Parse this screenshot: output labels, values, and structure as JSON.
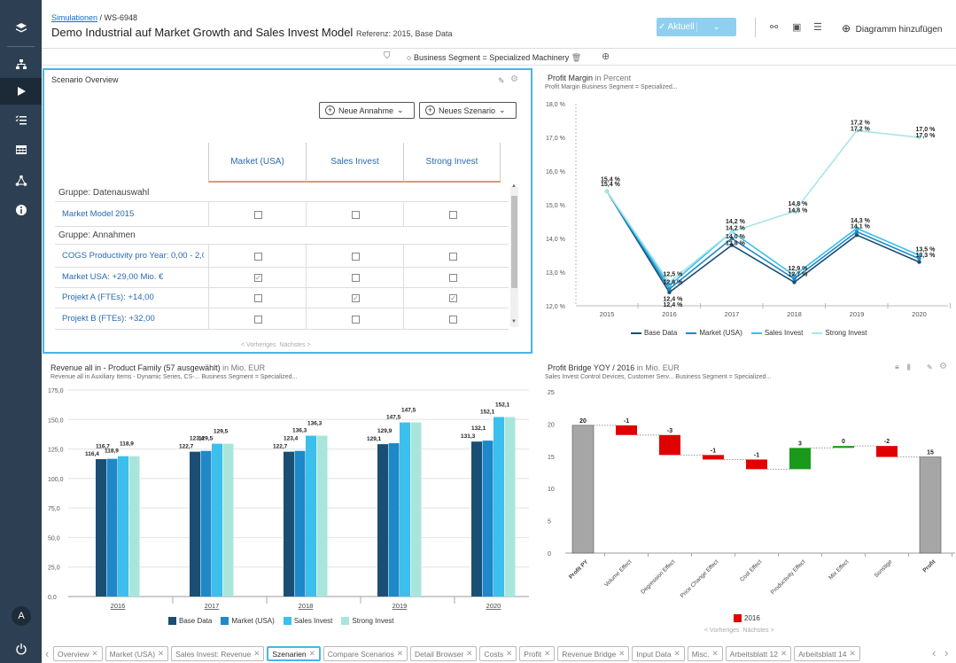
{
  "header": {
    "breadcrumb_link": "Simulationen",
    "breadcrumb_sep": " / ",
    "breadcrumb_id": "WS-6948",
    "title": "Demo Industrial auf Market Growth and Sales Invest Model",
    "reference": "Referenz: 2015, Base Data",
    "aktuell_label": "Aktuell",
    "add_diagram_label": "Diagramm hinzufügen"
  },
  "filter": {
    "label": "Business Segment = Specialized Machinery"
  },
  "scenario": {
    "title": "Scenario Overview",
    "new_assumption": "Neue Annahme",
    "new_scenario": "Neues Szenario",
    "columns": [
      "Market (USA)",
      "Sales Invest",
      "Strong Invest"
    ],
    "group1": "Gruppe: Datenauswahl",
    "group2": "Gruppe: Annahmen",
    "rows": [
      {
        "label": "Market Model 2015",
        "checks": [
          false,
          false,
          false
        ]
      },
      {
        "label": "COGS Productivity pro Year: 0,00 - 2,0",
        "checks": [
          false,
          false,
          false
        ]
      },
      {
        "label": "Market USA: +29,00 Mio. €",
        "checks": [
          true,
          false,
          false
        ]
      },
      {
        "label": "Projekt A (FTEs): +14,00",
        "checks": [
          false,
          true,
          true
        ]
      },
      {
        "label": "Projekt B (FTEs): +32,00",
        "checks": [
          false,
          false,
          false
        ]
      }
    ],
    "pager_prev": "< Vorheriges",
    "pager_next": "Nächstes >"
  },
  "profit_margin": {
    "title": "Profit Margin",
    "unit": "in Percent",
    "subtitle": "Profit Margin    Business Segment = Specialized..."
  },
  "revenue": {
    "title": "Revenue all in - Product Family (57 ausgewählt)",
    "unit": "in Mio. EUR",
    "subtitle": "Revenue all in    Auxiliary Items - Dynamic Series, CS-...    Business Segment = Specialized..."
  },
  "bridge": {
    "title": "Profit Bridge YOY / 2016",
    "unit": "in Mio. EUR",
    "subtitle": "Sales Invest    Control Devices, Customer Serv...    Business Segment = Specialized...",
    "pager_prev": "< Vorheriges",
    "pager_next": "Nächstes >"
  },
  "chart_data": [
    {
      "type": "line",
      "title": "Profit Margin",
      "x": [
        "2015",
        "2016",
        "2017",
        "2018",
        "2019",
        "2020"
      ],
      "ylim": [
        12.0,
        18.0
      ],
      "yticks": [
        "12,0 %",
        "13,0 %",
        "14,0 %",
        "15,0 %",
        "16,0 %",
        "17,0 %",
        "18,0 %"
      ],
      "series": [
        {
          "name": "Base Data",
          "color": "#1a4f73",
          "values": [
            15.4,
            12.4,
            13.8,
            12.7,
            14.1,
            13.3
          ]
        },
        {
          "name": "Market (USA)",
          "color": "#1e88c8",
          "values": [
            15.4,
            12.5,
            14.0,
            12.8,
            14.2,
            13.4
          ]
        },
        {
          "name": "Sales Invest",
          "color": "#3bbfec",
          "values": [
            15.4,
            12.6,
            14.2,
            12.9,
            14.3,
            13.5
          ]
        },
        {
          "name": "Strong Invest",
          "color": "#a8e6e8",
          "values": [
            15.4,
            12.7,
            14.2,
            14.8,
            17.2,
            17.0
          ]
        }
      ],
      "labels": {
        "2015": [
          "15,4 %",
          "15,4 %"
        ],
        "2016": [
          "12,5 %",
          "12,6 %",
          "12,4 %",
          "12,4 %"
        ],
        "2017": [
          "14,2 %",
          "14,2 %",
          "14,0 %",
          "13,8 %"
        ],
        "2018": [
          "14,8 %",
          "14,8 %",
          "12,9 %",
          "12,7 %"
        ],
        "2019": [
          "17,2 %",
          "17,2 %",
          "14,3 %",
          "14,1 %"
        ],
        "2020": [
          "17,0 %",
          "17,0 %",
          "13,5 %",
          "13,3 %"
        ]
      }
    },
    {
      "type": "bar",
      "title": "Revenue all in - Product Family (57 ausgewählt)",
      "categories": [
        "2016",
        "2017",
        "2018",
        "2019",
        "2020"
      ],
      "ylim": [
        0,
        175
      ],
      "yticks": [
        "0,0",
        "25,0",
        "50,0",
        "75,0",
        "100,0",
        "125,0",
        "150,0",
        "175,0"
      ],
      "series": [
        {
          "name": "Base Data",
          "color": "#1a4f73",
          "values": [
            116.4,
            122.7,
            122.7,
            129.1,
            131.3
          ]
        },
        {
          "name": "Market (USA)",
          "color": "#1e88c8",
          "values": [
            116.7,
            123.4,
            123.4,
            129.9,
            132.1
          ]
        },
        {
          "name": "Sales Invest",
          "color": "#3bbfec",
          "values": [
            118.9,
            129.5,
            136.3,
            147.5,
            152.1
          ]
        },
        {
          "name": "Strong Invest",
          "color": "#a8e6dc",
          "values": [
            118.9,
            129.5,
            136.3,
            147.5,
            152.1
          ]
        }
      ],
      "data_labels": [
        [
          "116,4",
          "116,7",
          "118,9",
          "118,9"
        ],
        [
          "122,7",
          "123,4",
          "129,5",
          "129,5"
        ],
        [
          "122,7",
          "123,4",
          "136,3",
          "136,3"
        ],
        [
          "129,1",
          "129,9",
          "147,5",
          "147,5"
        ],
        [
          "131,3",
          "132,1",
          "152,1",
          "152,1"
        ]
      ]
    },
    {
      "type": "bar",
      "title": "Profit Bridge YOY / 2016",
      "categories": [
        "Profit PY",
        "Volume Effect",
        "Degression Effect",
        "Price Change Effect",
        "Cost Effect",
        "Productivity Effect",
        "Mix Effect",
        "Sonstige",
        "Profit"
      ],
      "ylim": [
        0,
        25
      ],
      "yticks": [
        "0",
        "5",
        "10",
        "15",
        "20",
        "25"
      ],
      "steps": [
        {
          "label": "20",
          "start": 0,
          "end": 19.8,
          "kind": "total"
        },
        {
          "label": "-1",
          "start": 19.8,
          "end": 18.3,
          "kind": "neg"
        },
        {
          "label": "-3",
          "start": 18.3,
          "end": 15.2,
          "kind": "neg"
        },
        {
          "label": "-1",
          "start": 15.2,
          "end": 14.5,
          "kind": "neg"
        },
        {
          "label": "-1",
          "start": 14.5,
          "end": 13.0,
          "kind": "neg"
        },
        {
          "label": "3",
          "start": 13.0,
          "end": 16.3,
          "kind": "pos"
        },
        {
          "label": "0",
          "start": 16.3,
          "end": 16.6,
          "kind": "pos"
        },
        {
          "label": "-2",
          "start": 16.6,
          "end": 14.9,
          "kind": "neg"
        },
        {
          "label": "15",
          "start": 0,
          "end": 14.9,
          "kind": "total"
        }
      ],
      "legend": "2016",
      "colors": {
        "total": "#a6a6a6",
        "neg": "#e00000",
        "pos": "#1a9a1a"
      }
    }
  ],
  "tabs": [
    {
      "label": "Overview",
      "active": false
    },
    {
      "label": "Market (USA)",
      "active": false
    },
    {
      "label": "Sales Invest: Revenue",
      "active": false
    },
    {
      "label": "Szenarien",
      "active": true
    },
    {
      "label": "Compare Scenarios",
      "active": false
    },
    {
      "label": "Detail Browser",
      "active": false
    },
    {
      "label": "Costs",
      "active": false
    },
    {
      "label": "Profit",
      "active": false
    },
    {
      "label": "Revenue Bridge",
      "active": false
    },
    {
      "label": "Input Data",
      "active": false
    },
    {
      "label": "Misc.",
      "active": false
    },
    {
      "label": "Arbeitsblatt 12",
      "active": false
    },
    {
      "label": "Arbeitsblatt 14",
      "active": false
    }
  ],
  "sidebar": {
    "items": [
      "layers-icon",
      "hierarchy-icon",
      "play-icon",
      "checklist-icon",
      "table-icon",
      "network-icon",
      "info-icon"
    ],
    "avatar": "A"
  }
}
